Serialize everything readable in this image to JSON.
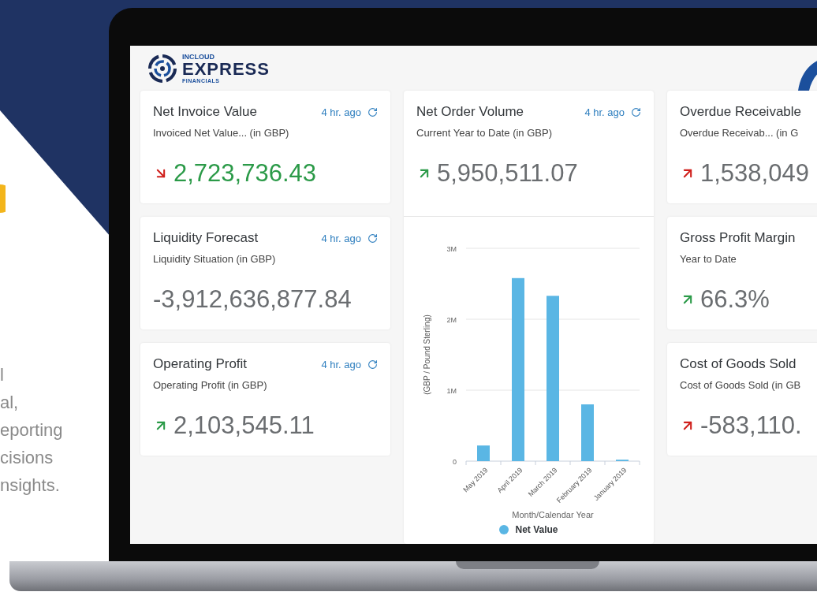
{
  "promo_text": {
    "lines": [
      "l",
      "al,",
      "eporting",
      "cisions",
      "nsights."
    ]
  },
  "logo": {
    "top": "INCLOUD",
    "main": "EXPRESS",
    "bottom": "FINANCIALS"
  },
  "columns": [
    {
      "cards": [
        {
          "kind": "kpi",
          "title": "Net Invoice Value",
          "time": "4 hr. ago",
          "subtitle": "Invoiced Net Value... (in GBP)",
          "value": "2,723,736.43",
          "trend": {
            "rising": false,
            "good": false
          },
          "value_good": true
        },
        {
          "kind": "kpi",
          "title": "Liquidity Forecast",
          "time": "4 hr. ago",
          "subtitle": "Liquidity Situation (in GBP)",
          "value": "-3,912,636,877.84",
          "value_good": false
        },
        {
          "kind": "kpi",
          "title": "Operating Profit",
          "time": "4 hr. ago",
          "subtitle": "Operating Profit (in GBP)",
          "value": "2,103,545.11",
          "trend": {
            "rising": true,
            "good": true
          },
          "value_good": false
        }
      ]
    },
    {
      "cards": [
        {
          "kind": "kpi_chart",
          "title": "Net Order Volume",
          "time": "4 hr. ago",
          "subtitle": "Current Year to Date (in GBP)",
          "value": "5,950,511.07",
          "trend": {
            "rising": true,
            "good": true
          },
          "value_good": false,
          "chart_data": {
            "type": "bar",
            "ylabel": "(GBP / Pound Sterling)",
            "xlabel": "Month/Calendar Year",
            "categories": [
              "May 2019",
              "April 2019",
              "March 2019",
              "February 2019",
              "January 2019"
            ],
            "series": [
              {
                "name": "Net Value",
                "color": "#5ab6e4",
                "values": [
                  220000,
                  2580000,
                  2330000,
                  800000,
                  20000
                ]
              }
            ],
            "ylim": [
              0,
              3000000
            ],
            "yticks": [
              {
                "value": 0,
                "label": "0"
              },
              {
                "value": 1000000,
                "label": "1M"
              },
              {
                "value": 2000000,
                "label": "2M"
              },
              {
                "value": 3000000,
                "label": "3M"
              }
            ]
          }
        }
      ]
    },
    {
      "cards": [
        {
          "kind": "kpi",
          "title": "Overdue Receivable",
          "subtitle": "Overdue Receivab...  (in G",
          "value": "1,538,049",
          "trend": {
            "rising": true,
            "good": false
          },
          "value_good": false
        },
        {
          "kind": "kpi",
          "title": "Gross Profit Margin",
          "subtitle": "Year to Date",
          "value": "66.3%",
          "trend": {
            "rising": true,
            "good": true
          },
          "value_good": false
        },
        {
          "kind": "kpi",
          "title": "Cost of Goods Sold",
          "subtitle": "Cost of Goods Sold (in GB",
          "value": "-583,110.",
          "trend": {
            "rising": true,
            "good": false
          },
          "value_good": false
        }
      ]
    }
  ]
}
